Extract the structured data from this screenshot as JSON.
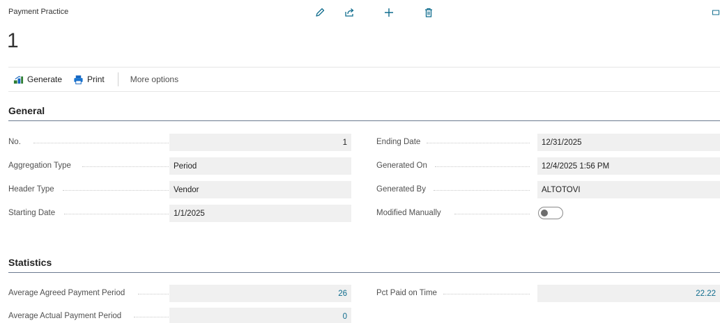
{
  "header": {
    "page_caption": "Payment Practice",
    "record_title": "1"
  },
  "toolbar_icons": [
    "edit-icon",
    "share-icon",
    "add-icon",
    "delete-icon",
    "collapse-icon"
  ],
  "actions": {
    "generate": "Generate",
    "print": "Print",
    "more_options": "More options"
  },
  "general": {
    "title": "General",
    "no_label": "No.",
    "no_value": "1",
    "aggregation_type_label": "Aggregation Type",
    "aggregation_type_value": "Period",
    "header_type_label": "Header Type",
    "header_type_value": "Vendor",
    "starting_date_label": "Starting Date",
    "starting_date_value": "1/1/2025",
    "ending_date_label": "Ending Date",
    "ending_date_value": "12/31/2025",
    "generated_on_label": "Generated On",
    "generated_on_value": "12/4/2025 1:56 PM",
    "generated_by_label": "Generated By",
    "generated_by_value": "ALTOTOVI",
    "modified_manually_label": "Modified Manually",
    "modified_manually_value": false
  },
  "statistics": {
    "title": "Statistics",
    "avg_agreed_label": "Average Agreed Payment Period",
    "avg_agreed_value": "26",
    "avg_actual_label": "Average Actual Payment Period",
    "avg_actual_value": "0",
    "pct_paid_label": "Pct Paid on Time",
    "pct_paid_value": "22.22"
  },
  "colors": {
    "accent": "#0f6c8d",
    "field_bg": "#f0f0f0",
    "section_rule": "#6b7a8f"
  }
}
